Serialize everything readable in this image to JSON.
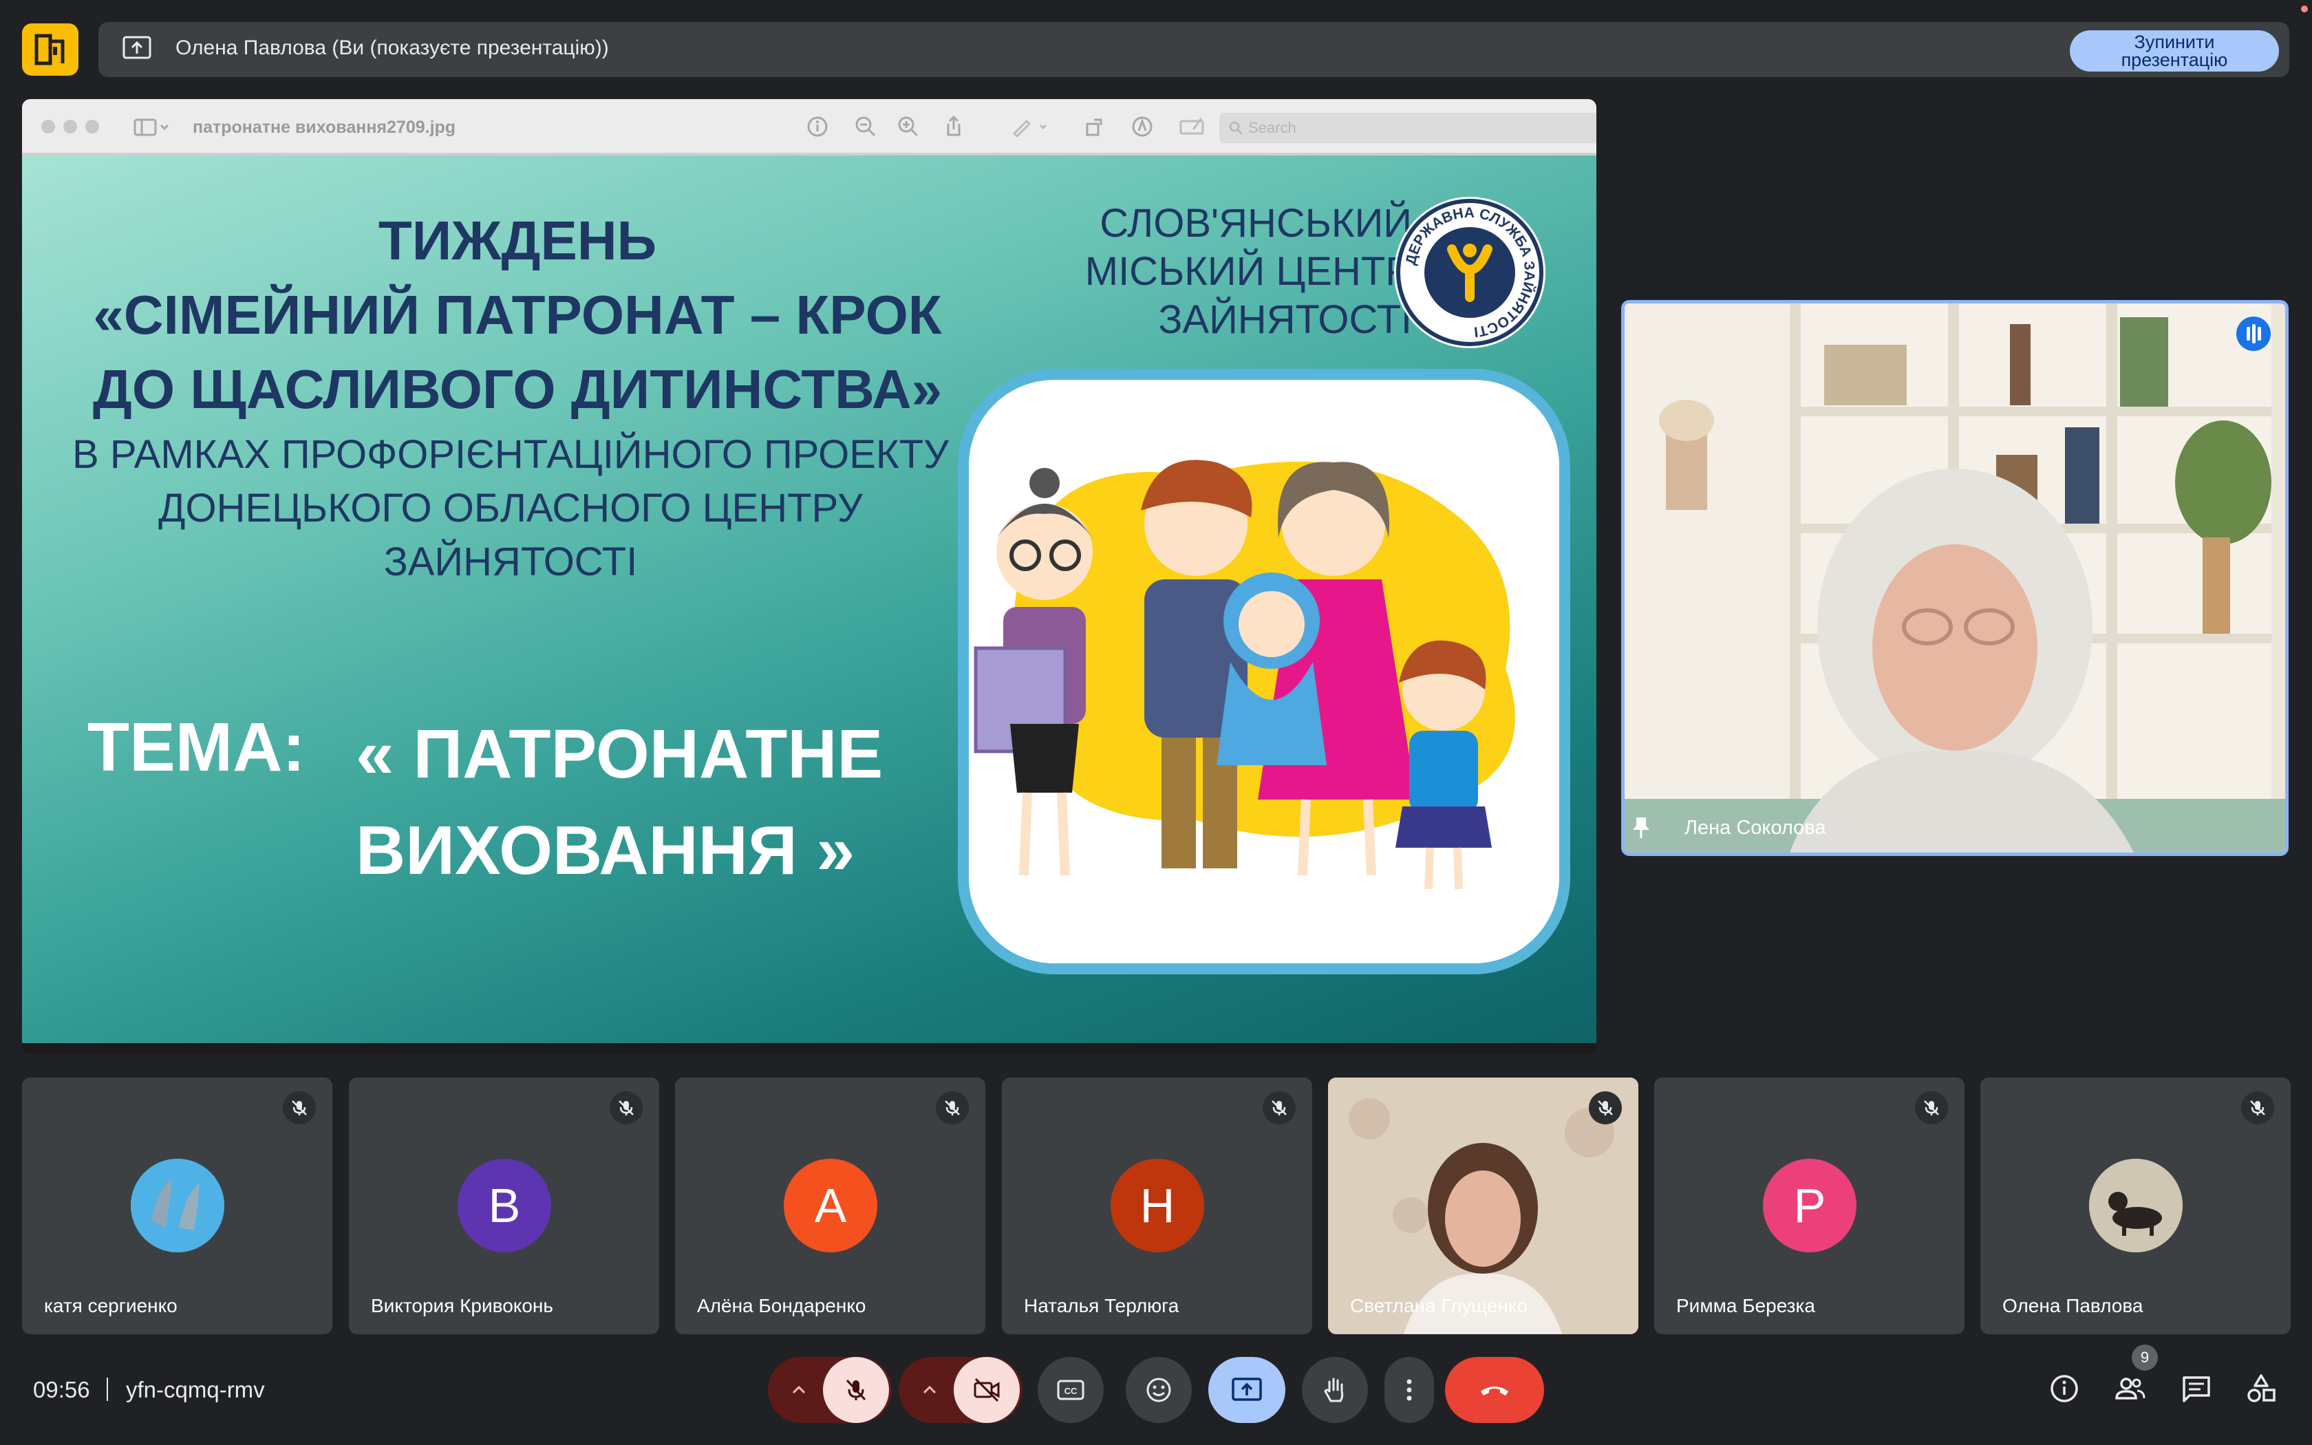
{
  "presentation_bar": {
    "text": "Олена Павлова (Ви (показуєте презентацію))",
    "stop_button_line1": "Зупинити",
    "stop_button_line2": "презентацію"
  },
  "viewer": {
    "file_name": "патронатне виховання2709.jpg",
    "search_placeholder": "Search"
  },
  "slide": {
    "title_line1": "ТИЖДЕНЬ",
    "title_line2": "«СІМЕЙНИЙ ПАТРОНАТ – КРОК",
    "title_line3": "ДО ЩАСЛИВОГО ДИТИНСТВА»",
    "org_line1": "СЛОВ'ЯНСЬКИЙ",
    "org_line2": "МІСЬКИЙ ЦЕНТР",
    "org_line3": "ЗАЙНЯТОСТІ",
    "subtitle_line1": "В РАМКАХ ПРОФОРІЄНТАЦІЙНОГО ПРОЕКТУ",
    "subtitle_line2": "ДОНЕЦЬКОГО ОБЛАСНОГО ЦЕНТРУ",
    "subtitle_line3": "ЗАЙНЯТОСТІ",
    "tema_label": "ТЕМА:",
    "theme_line1": "« ПАТРОНАТНЕ",
    "theme_line2": "ВИХОВАННЯ »",
    "emblem_text": "ДЕРЖАВНА СЛУЖБА ЗАЙНЯТОСТІ"
  },
  "speaker": {
    "name": "Лена Соколова"
  },
  "participants": [
    {
      "name": "катя сергиенко",
      "initial": "",
      "avatar": "dolphin-photo",
      "color": "#3aa0d8"
    },
    {
      "name": "Виктория Кривоконь",
      "initial": "В",
      "color": "#5e35b1"
    },
    {
      "name": "Алёна Бондаренко",
      "initial": "А",
      "color": "#f4511e"
    },
    {
      "name": "Наталья Терлюга",
      "initial": "Н",
      "color": "#bf360c"
    },
    {
      "name": "Светлана Глущенко",
      "initial": "",
      "avatar": "video",
      "color": "#d8cbb8"
    },
    {
      "name": "Римма Березка",
      "initial": "Р",
      "color": "#ec407a"
    },
    {
      "name": "Олена Павлова",
      "initial": "",
      "avatar": "dog-photo",
      "color": "#b5ab97"
    }
  ],
  "bottom_bar": {
    "time": "09:56",
    "meeting_code": "yfn-cqmq-rmv",
    "people_count": "9"
  },
  "colors": {
    "background": "#202124",
    "tile": "#3c4043",
    "accent_blue": "#8ab4f8",
    "end_call_red": "#ea4335",
    "muted_red": "#f9dedc"
  }
}
